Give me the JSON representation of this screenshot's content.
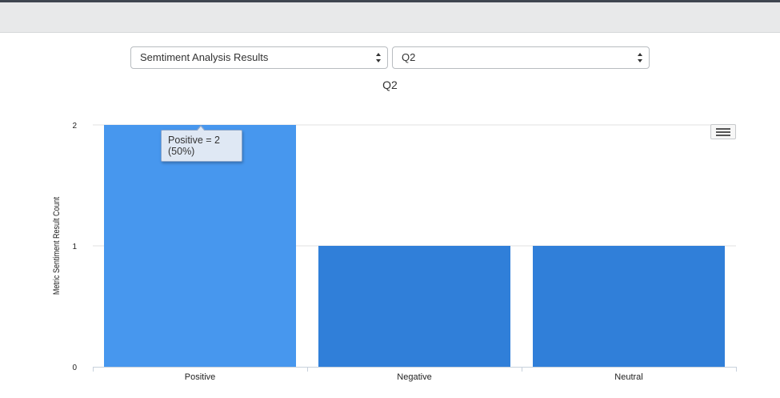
{
  "controls": {
    "report_select": "Semtiment Analysis Results",
    "question_select": "Q2"
  },
  "tooltip": {
    "line1": "Positive = 2",
    "line2": "(50%)"
  },
  "icons": {
    "chart_menu": "hamburger-menu-icon"
  },
  "colors": {
    "bar": "#307fd9",
    "bar_hover": "#4797ee",
    "grid": "#e0e0e0"
  },
  "chart_data": {
    "type": "bar",
    "title": "Q2",
    "xlabel": "",
    "ylabel": "Metric Sentiment Result Count",
    "categories": [
      "Positive",
      "Negative",
      "Neutral"
    ],
    "series": [
      {
        "values": [
          2,
          1,
          1
        ]
      }
    ],
    "ylim": [
      0,
      2
    ],
    "yticks": [
      0,
      1,
      2
    ],
    "grid": true,
    "highlighted_category": "Positive"
  }
}
